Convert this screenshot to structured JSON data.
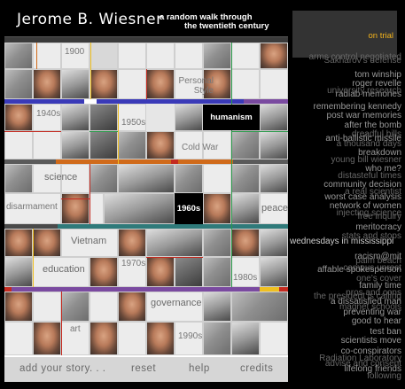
{
  "header": {
    "title": "Jerome B. Wiesner",
    "subtitle_line1": "a random walk through",
    "subtitle_line2": "the twentieth century"
  },
  "grid_labels": {
    "year_1900": "1900",
    "personal_style": "Personal Style",
    "year_1940s": "1940s",
    "year_1950s": "1950s",
    "humanism": "humanism",
    "cold_war": "Cold War",
    "science": "science",
    "disarmament": "disarmament",
    "year_1960s": "1960s",
    "peace": "peace",
    "vietnam": "Vietnam",
    "education": "education",
    "year_1970s": "1970s",
    "year_1980s": "1980s",
    "governance": "governance",
    "art": "art",
    "year_1990s": "1990s"
  },
  "footer": {
    "add_story": "add your story. . .",
    "reset": "reset",
    "help": "help",
    "credits": "credits"
  },
  "stories": {
    "selected": "on trial",
    "items": [
      "arms control negotiated",
      "Sakharov's defense",
      "tom winship",
      "roger revelle",
      "radlab memories",
      "university research",
      "remembering kennedy",
      "post war memories",
      "after the bomb",
      "dreadful bills",
      "anti-ballistic missile",
      "a thousand days",
      "breakdown",
      "young bill wiesner",
      "who me?",
      "distasteful times",
      "community decision",
      "a real scientist",
      "worst case analysis",
      "network of women",
      "injecting science",
      "free inquiry",
      "meritocracy",
      "stats and stops",
      "wednesdays in mississippi",
      "racism@mit",
      "palm beach",
      "campus unrest",
      "affable spokesperson",
      "one's cover",
      "family time",
      "pros and cons",
      "the president is calling",
      "a dissatisfied man",
      "magnet schools",
      "preventing war",
      "good to hear",
      "test ban",
      "scientists move",
      "co-conspirators",
      "Radiation Laboratory",
      "advise and consent",
      "lifelong friends",
      "following"
    ]
  },
  "colors": {
    "accent_orange": "#f3b31b",
    "bar_blue": "#3a3ab8",
    "bar_purple": "#7a4aa0",
    "bar_orange": "#d06a1a",
    "bar_red": "#c42a20",
    "bar_teal": "#2f7a7a",
    "bar_yellow": "#f0c020",
    "bar_green": "#2a9a4a"
  },
  "icons": [
    "photo-thumbnail",
    "portrait-thumbnail"
  ]
}
